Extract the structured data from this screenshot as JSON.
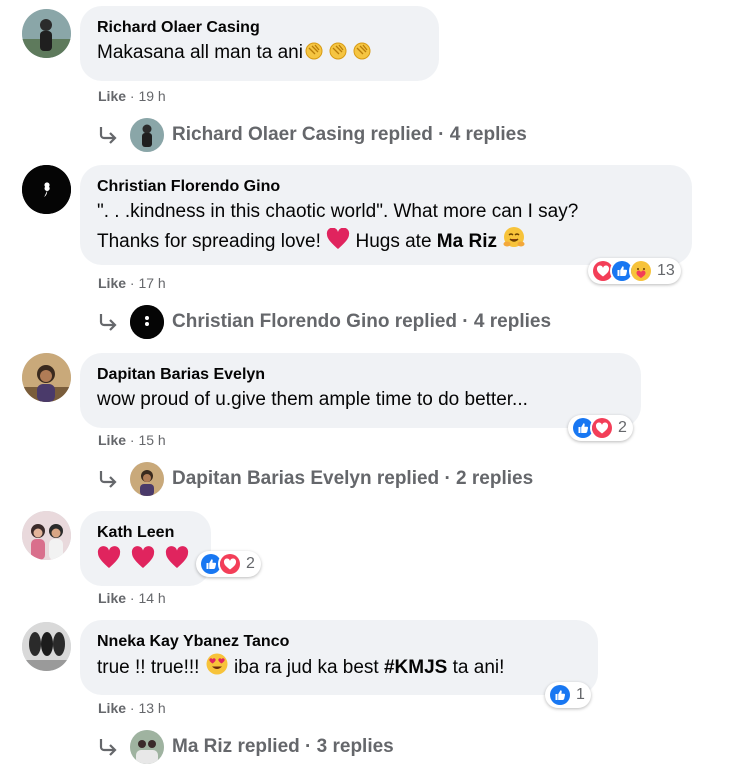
{
  "comments": [
    {
      "name": "Richard Olaer Casing",
      "text": "Makasana all man ta ani",
      "meta": {
        "like": "Like",
        "time": "19 h"
      },
      "reply": {
        "label": "Richard Olaer Casing replied · 4 replies"
      }
    },
    {
      "name": "Christian Florendo Gino",
      "line1": "\". . .kindness in this chaotic world\". What more can I say?",
      "line2_pre": "Thanks for spreading love!",
      "line2_mid": "Hugs ate",
      "line2_bold": "Ma Riz",
      "reactions": {
        "count": "13",
        "icons": [
          "love",
          "like",
          "care"
        ]
      },
      "meta": {
        "like": "Like",
        "time": "17 h"
      },
      "reply": {
        "label": "Christian Florendo Gino replied · 4 replies"
      }
    },
    {
      "name": "Dapitan Barias Evelyn",
      "text": "wow proud of u.give them ample time to do better...",
      "reactions": {
        "count": "2",
        "icons": [
          "like",
          "love"
        ]
      },
      "meta": {
        "like": "Like",
        "time": "15 h"
      },
      "reply": {
        "label": "Dapitan Barias Evelyn replied · 2 replies"
      }
    },
    {
      "name": "Kath Leen",
      "reactions": {
        "count": "2",
        "icons": [
          "like",
          "love"
        ]
      },
      "meta": {
        "like": "Like",
        "time": "14 h"
      }
    },
    {
      "name": "Nneka Kay Ybanez Tanco",
      "text_pre": "true !! true!!!",
      "text_mid": "iba ra jud ka best",
      "text_bold": "#KMJS",
      "text_post": "ta ani!",
      "reactions": {
        "count": "1",
        "icons": [
          "like"
        ]
      },
      "meta": {
        "like": "Like",
        "time": "13 h"
      },
      "reply": {
        "label": "Ma Riz replied · 3 replies"
      }
    }
  ],
  "separator": "·",
  "colors": {
    "bubble": "#f0f2f5",
    "meta": "#65676b",
    "like_blue": "#1877f2",
    "love_red": "#f33e58",
    "heart": "#e0245e"
  }
}
